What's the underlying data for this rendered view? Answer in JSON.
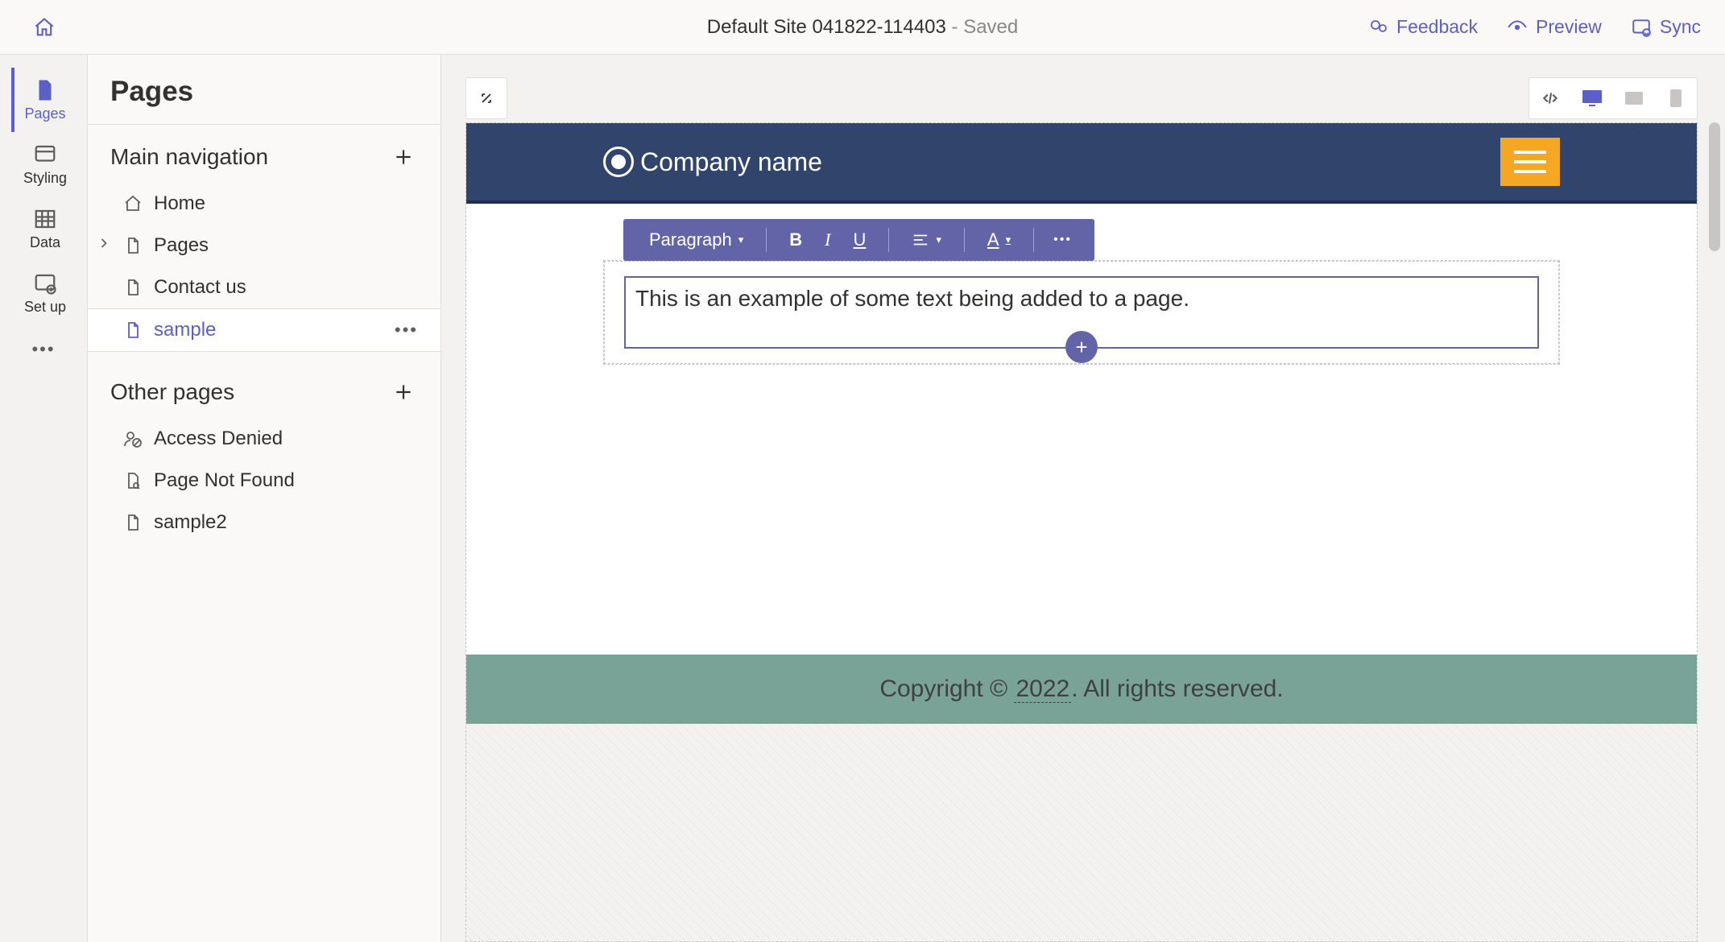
{
  "topbar": {
    "title": "Default Site 041822-114403",
    "saved_suffix": " - Saved",
    "feedback_label": "Feedback",
    "preview_label": "Preview",
    "sync_label": "Sync"
  },
  "rail": {
    "pages": "Pages",
    "styling": "Styling",
    "data": "Data",
    "setup": "Set up"
  },
  "panel": {
    "header": "Pages",
    "main_nav_title": "Main navigation",
    "other_pages_title": "Other pages",
    "items_main": {
      "home": "Home",
      "pages": "Pages",
      "contact": "Contact us",
      "sample": "sample"
    },
    "items_other": {
      "access_denied": "Access Denied",
      "not_found": "Page Not Found",
      "sample2": "sample2"
    }
  },
  "site": {
    "company_name": "Company name",
    "editor_text": "This is an example of some text being added to a page.",
    "paragraph_label": "Paragraph",
    "bold_label": "B",
    "italic_label": "I",
    "underline_label": "U",
    "fontcolor_label": "A",
    "footer_prefix": "Copyright © ",
    "footer_year": "2022",
    "footer_suffix": ". All rights reserved."
  }
}
